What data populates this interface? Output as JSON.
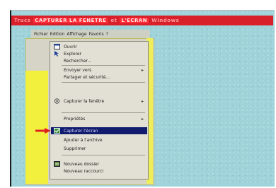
{
  "banner": {
    "segments": [
      "Trucs",
      "CAPTURER LA FENETRE",
      "et",
      "L'ECRAN",
      "Windows"
    ]
  },
  "menubar": {
    "items": [
      "Fichier",
      "Edition",
      "Affichage",
      "Favoris",
      "?"
    ]
  },
  "context_menu": {
    "items": [
      {
        "label": "Ouvrir",
        "has_submenu": false
      },
      {
        "label": "Explorer",
        "has_submenu": false
      },
      {
        "label": "Rechercher...",
        "has_submenu": false
      },
      {
        "label": "Envoyer vers",
        "has_submenu": true
      },
      {
        "label": "Partager et sécurité...",
        "has_submenu": false
      },
      {
        "label": "Capturer la fenêtre",
        "has_submenu": true
      },
      {
        "label": "Propriétés",
        "has_submenu": true
      },
      {
        "label": "Capturer l'écran",
        "has_submenu": false,
        "selected": true
      },
      {
        "label": "Ajouter à l'archive",
        "has_submenu": false
      },
      {
        "label": "Supprimer",
        "has_submenu": false
      },
      {
        "label": "Nouveau dossier",
        "has_submenu": false
      },
      {
        "label": "Nouveau raccourci",
        "has_submenu": false
      }
    ]
  },
  "colors": {
    "background": "#9fd3da",
    "banner": "#d8202a",
    "menu_bg": "#e2e0d4",
    "selection": "#121c6e",
    "yellow_panel": "#f3ef3d",
    "arrow": "#e02020"
  },
  "icons": [
    "window-icon",
    "cursor-icon",
    "check-icon",
    "folder-icon",
    "red-arrow-icon"
  ]
}
